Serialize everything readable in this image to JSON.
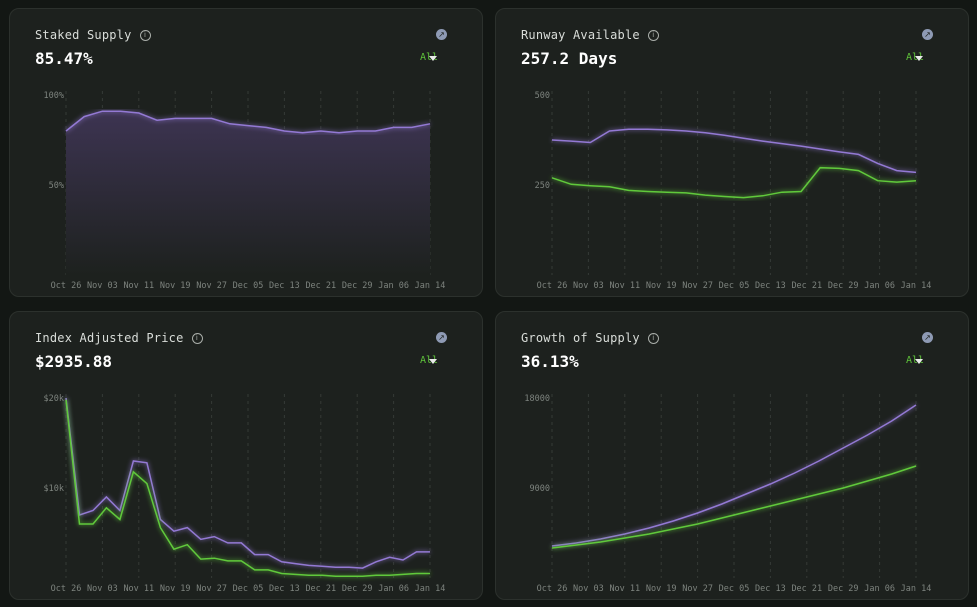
{
  "cards": [
    {
      "title": "Staked Supply",
      "value": "85.47%",
      "range": "All"
    },
    {
      "title": "Runway Available",
      "value": "257.2 Days",
      "range": "All"
    },
    {
      "title": "Index Adjusted Price",
      "value": "$2935.88",
      "range": "All"
    },
    {
      "title": "Growth of Supply",
      "value": "36.13%",
      "range": "All"
    }
  ],
  "icons": {
    "info": "info-icon",
    "external": "external-link-icon",
    "dropdown": "chevron-down-icon"
  },
  "colors": {
    "purple": "#9379d4",
    "green": "#61c93b",
    "background": "#1d211e"
  },
  "chart_data": [
    {
      "type": "area",
      "title": "Staked Supply",
      "x": [
        "Oct 26",
        "Nov 03",
        "Nov 11",
        "Nov 19",
        "Nov 27",
        "Dec 05",
        "Dec 13",
        "Dec 21",
        "Dec 29",
        "Jan 06",
        "Jan 14"
      ],
      "ytick_labels": [
        "100%",
        "50%"
      ],
      "ylim": [
        0,
        100
      ],
      "grid": true,
      "series": [
        {
          "values": [
            80,
            88,
            91,
            91,
            90,
            86,
            87,
            87,
            87,
            84,
            83,
            82,
            80,
            79,
            80,
            79,
            80,
            80,
            82,
            82,
            84
          ]
        }
      ]
    },
    {
      "type": "line",
      "title": "Runway Available",
      "x": [
        "Oct 26",
        "Nov 03",
        "Nov 11",
        "Nov 19",
        "Nov 27",
        "Dec 05",
        "Dec 13",
        "Dec 21",
        "Dec 29",
        "Jan 06",
        "Jan 14"
      ],
      "ytick_labels": [
        "500",
        "250"
      ],
      "ylim": [
        0,
        500
      ],
      "grid": true,
      "series": [
        {
          "values": [
            375,
            372,
            368,
            400,
            405,
            405,
            403,
            400,
            395,
            388,
            380,
            372,
            365,
            358,
            350,
            342,
            335,
            310,
            290,
            285
          ]
        },
        {
          "values": [
            270,
            252,
            248,
            245,
            235,
            232,
            230,
            228,
            222,
            218,
            215,
            220,
            230,
            232,
            298,
            296,
            290,
            262,
            258,
            262
          ]
        }
      ]
    },
    {
      "type": "line",
      "title": "Index Adjusted Price",
      "x": [
        "Oct 26",
        "Nov 03",
        "Nov 11",
        "Nov 19",
        "Nov 27",
        "Dec 05",
        "Dec 13",
        "Dec 21",
        "Dec 29",
        "Jan 06",
        "Jan 14"
      ],
      "ytick_labels": [
        "$20k",
        "$10k"
      ],
      "ylim": [
        0,
        20000
      ],
      "grid": true,
      "series": [
        {
          "values": [
            20000,
            7000,
            7500,
            9000,
            7500,
            13000,
            12800,
            6500,
            5200,
            5600,
            4300,
            4600,
            3900,
            3900,
            2600,
            2600,
            1800,
            1600,
            1400,
            1300,
            1200,
            1200,
            1100,
            1800,
            2300,
            2000,
            2900,
            2900
          ]
        },
        {
          "values": [
            19800,
            6000,
            6000,
            7800,
            6500,
            11800,
            10500,
            5600,
            3200,
            3700,
            2100,
            2200,
            1900,
            1900,
            900,
            900,
            500,
            400,
            300,
            300,
            200,
            200,
            200,
            300,
            300,
            400,
            500,
            500
          ]
        }
      ]
    },
    {
      "type": "line",
      "title": "Growth of Supply",
      "x": [
        "Oct 26",
        "Nov 03",
        "Nov 11",
        "Nov 19",
        "Nov 27",
        "Dec 05",
        "Dec 13",
        "Dec 21",
        "Dec 29",
        "Jan 06",
        "Jan 14"
      ],
      "ytick_labels": [
        "18000",
        "9000"
      ],
      "ylim": [
        0,
        18000
      ],
      "grid": true,
      "series": [
        {
          "values": [
            3200,
            3500,
            3900,
            4400,
            5000,
            5700,
            6500,
            7400,
            8400,
            9400,
            10500,
            11700,
            13000,
            14300,
            15700,
            17300
          ]
        },
        {
          "values": [
            3000,
            3300,
            3600,
            4000,
            4400,
            4900,
            5400,
            6000,
            6600,
            7200,
            7800,
            8400,
            9000,
            9700,
            10400,
            11200
          ]
        }
      ]
    }
  ]
}
